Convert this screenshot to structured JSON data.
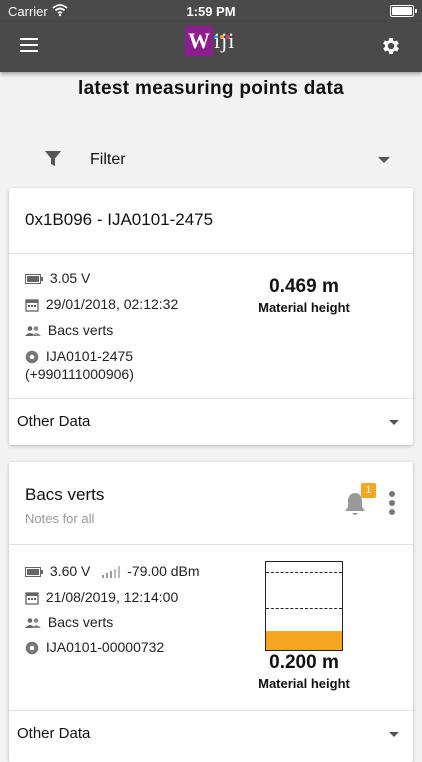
{
  "status_bar": {
    "carrier": "Carrier",
    "time": "1:59 PM"
  },
  "app_bar": {
    "logo_initial": "W",
    "logo_rest": "iji",
    "icons": {
      "menu": "hamburger-icon",
      "settings": "gear-icon"
    }
  },
  "page": {
    "title": "latest measuring points data"
  },
  "filter": {
    "label": "Filter"
  },
  "cards": [
    {
      "title": "0x1B096 - IJA0101-2475",
      "battery": "3.05 V",
      "date": "29/01/2018, 02:12:32",
      "group": "Bacs verts",
      "device": "IJA0101-2475",
      "device_phone": "(+990111000906)",
      "measure_value": "0.469 m",
      "measure_label": "Material height",
      "footer": "Other Data"
    },
    {
      "title": "Bacs verts",
      "subtitle": "Notes for all",
      "badge": "1",
      "battery": "3.60 V",
      "signal": "-79.00 dBm",
      "date": "21/08/2019, 12:14:00",
      "group": "Bacs verts",
      "device": "IJA0101-00000732",
      "measure_value": "0.200 m",
      "measure_label": "Material height",
      "fill_fraction": 0.22,
      "footer": "Other Data"
    }
  ],
  "colors": {
    "appbar": "#4a4a4a",
    "brand": "#8c1f8d",
    "accent": "#f5a623"
  }
}
